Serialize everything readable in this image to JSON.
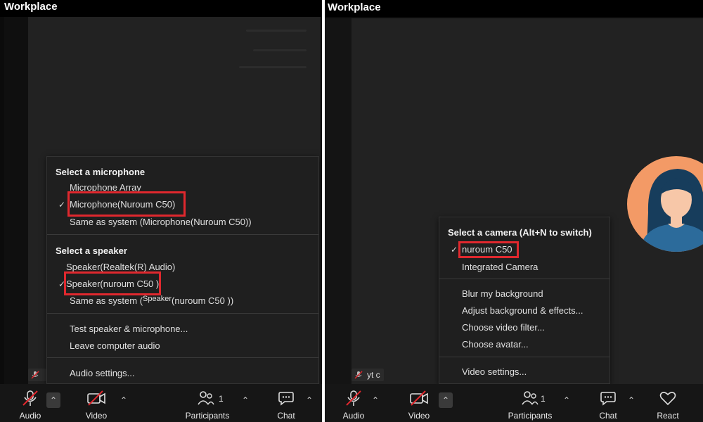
{
  "left": {
    "title": "Workplace",
    "audio_menu": {
      "mic_header": "Select a microphone",
      "mic_items": [
        "Microphone Array",
        "Microphone(Nuroum C50)",
        "Same as system  (Microphone(Nuroum C50))"
      ],
      "speaker_header": "Select a speaker",
      "speaker_items": [
        "Speaker(Realtek(R) Audio)",
        "Speaker(nuroum C50 )"
      ],
      "speaker_same_prefix": "Same as system (",
      "speaker_same_sup": "Speaker",
      "speaker_same_suffix": "(nuroum C50 ))",
      "test_label": "Test speaker & microphone...",
      "leave_label": "Leave computer audio",
      "settings_label": "Audio settings..."
    },
    "name_tag": "y",
    "toolbar": {
      "audio": "Audio",
      "video": "Video",
      "participants": "Participants",
      "participants_count": "1",
      "chat": "Chat"
    }
  },
  "right": {
    "title": "Workplace",
    "video_menu": {
      "camera_header": "Select a camera (Alt+N to switch)",
      "camera_items": [
        "nuroum C50",
        "Integrated Camera"
      ],
      "blur_label": "Blur my background",
      "adjust_label": "Adjust background & effects...",
      "filter_label": "Choose video filter...",
      "avatar_label": "Choose avatar...",
      "settings_label": "Video settings..."
    },
    "name_tag": "yt c",
    "toolbar": {
      "audio": "Audio",
      "video": "Video",
      "participants": "Participants",
      "participants_count": "1",
      "chat": "Chat",
      "react": "React"
    }
  },
  "colors": {
    "highlight": "#e0282e",
    "muted_slash": "#e0282e",
    "avatar_bg": "#f39a66",
    "avatar_hair": "#173d5c",
    "avatar_shirt": "#2c6b9b"
  },
  "icons": [
    "microphone-muted-icon",
    "video-off-icon",
    "participants-icon",
    "chat-icon",
    "heart-icon",
    "chevron-up-icon",
    "check-icon"
  ]
}
